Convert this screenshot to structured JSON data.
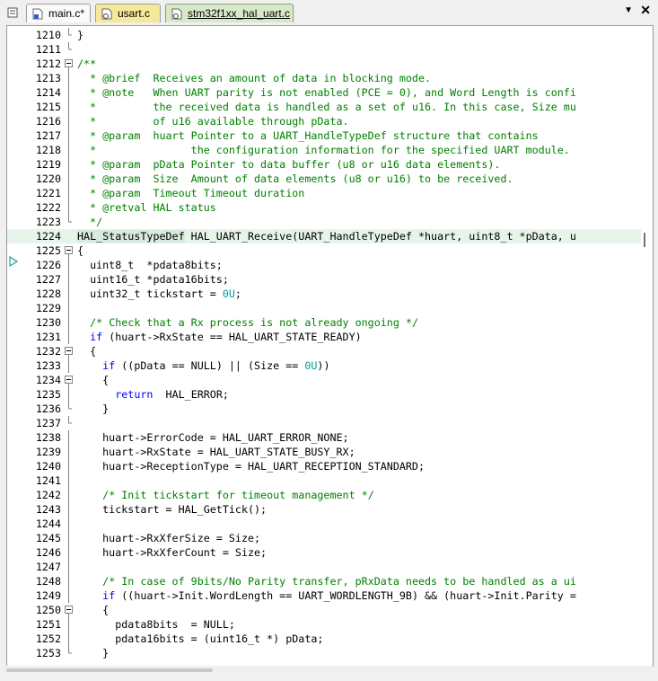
{
  "tabs": [
    {
      "label": "main.c*",
      "active": false
    },
    {
      "label": "usart.c",
      "active": false
    },
    {
      "label": "stm32f1xx_hal_uart.c",
      "active": true
    }
  ],
  "tab_controls": {
    "dropdown_icon": "chevron-down-icon",
    "close_icon": "close-icon"
  },
  "lines": [
    {
      "n": "1210",
      "fold": "end",
      "hl": false,
      "segs": [
        [
          "}",
          "d"
        ]
      ]
    },
    {
      "n": "1211",
      "fold": "end",
      "hl": false,
      "segs": []
    },
    {
      "n": "1212",
      "fold": "open",
      "hl": false,
      "segs": [
        [
          "/**",
          "c"
        ]
      ]
    },
    {
      "n": "1213",
      "fold": "line",
      "hl": false,
      "segs": [
        [
          "  * @brief  Receives an amount of data in blocking mode.",
          "c"
        ]
      ]
    },
    {
      "n": "1214",
      "fold": "line",
      "hl": false,
      "segs": [
        [
          "  * @note   When UART parity is not enabled (PCE = 0), and Word Length is confi",
          "c"
        ]
      ]
    },
    {
      "n": "1215",
      "fold": "line",
      "hl": false,
      "segs": [
        [
          "  *         the received data is handled as a set of u16. In this case, Size mu",
          "c"
        ]
      ]
    },
    {
      "n": "1216",
      "fold": "line",
      "hl": false,
      "segs": [
        [
          "  *         of u16 available through pData.",
          "c"
        ]
      ]
    },
    {
      "n": "1217",
      "fold": "line",
      "hl": false,
      "segs": [
        [
          "  * @param  huart Pointer to a UART_HandleTypeDef structure that contains",
          "c"
        ]
      ]
    },
    {
      "n": "1218",
      "fold": "line",
      "hl": false,
      "segs": [
        [
          "  *               the configuration information for the specified UART module.",
          "c"
        ]
      ]
    },
    {
      "n": "1219",
      "fold": "line",
      "hl": false,
      "segs": [
        [
          "  * @param  pData Pointer to data buffer (u8 or u16 data elements).",
          "c"
        ]
      ]
    },
    {
      "n": "1220",
      "fold": "line",
      "hl": false,
      "segs": [
        [
          "  * @param  Size  Amount of data elements (u8 or u16) to be received.",
          "c"
        ]
      ]
    },
    {
      "n": "1221",
      "fold": "line",
      "hl": false,
      "segs": [
        [
          "  * @param  Timeout Timeout duration",
          "c"
        ]
      ]
    },
    {
      "n": "1222",
      "fold": "line",
      "hl": false,
      "segs": [
        [
          "  * @retval HAL status",
          "c"
        ]
      ]
    },
    {
      "n": "1223",
      "fold": "end",
      "hl": false,
      "segs": [
        [
          "  */",
          "c"
        ]
      ]
    },
    {
      "n": "1224",
      "fold": "none",
      "hl": true,
      "segs": [
        [
          "HAL_StatusTypeDef",
          "w"
        ],
        [
          " HAL_UART_Receive(UART_HandleTypeDef *huart, uint8_t *pData, u",
          "d"
        ]
      ]
    },
    {
      "n": "1225",
      "fold": "open",
      "hl": false,
      "segs": [
        [
          "{",
          "d"
        ]
      ]
    },
    {
      "n": "1226",
      "fold": "line",
      "hl": false,
      "segs": [
        [
          "  uint8_t  *pdata8bits;",
          "d"
        ]
      ]
    },
    {
      "n": "1227",
      "fold": "line",
      "hl": false,
      "segs": [
        [
          "  uint16_t *pdata16bits;",
          "d"
        ]
      ]
    },
    {
      "n": "1228",
      "fold": "line",
      "hl": false,
      "segs": [
        [
          "  uint32_t tickstart = ",
          "d"
        ],
        [
          "0U",
          "n"
        ],
        [
          ";",
          "d"
        ]
      ]
    },
    {
      "n": "1229",
      "fold": "line",
      "hl": false,
      "segs": []
    },
    {
      "n": "1230",
      "fold": "line",
      "hl": false,
      "segs": [
        [
          "  ",
          "d"
        ],
        [
          "/* Check that a Rx process is not already ongoing */",
          "c"
        ]
      ]
    },
    {
      "n": "1231",
      "fold": "line",
      "hl": false,
      "segs": [
        [
          "  ",
          "d"
        ],
        [
          "if",
          "k"
        ],
        [
          " (huart->RxState == HAL_UART_STATE_READY)",
          "d"
        ]
      ]
    },
    {
      "n": "1232",
      "fold": "open",
      "hl": false,
      "segs": [
        [
          "  {",
          "d"
        ]
      ]
    },
    {
      "n": "1233",
      "fold": "line",
      "hl": false,
      "segs": [
        [
          "    ",
          "d"
        ],
        [
          "if",
          "k"
        ],
        [
          " ((pData == NULL) || (Size == ",
          "d"
        ],
        [
          "0U",
          "n"
        ],
        [
          "))",
          "d"
        ]
      ]
    },
    {
      "n": "1234",
      "fold": "open",
      "hl": false,
      "segs": [
        [
          "    {",
          "d"
        ]
      ]
    },
    {
      "n": "1235",
      "fold": "line",
      "hl": false,
      "segs": [
        [
          "      ",
          "d"
        ],
        [
          "return",
          "k"
        ],
        [
          "  HAL_ERROR;",
          "d"
        ]
      ]
    },
    {
      "n": "1236",
      "fold": "end",
      "hl": false,
      "segs": [
        [
          "    }",
          "d"
        ]
      ]
    },
    {
      "n": "1237",
      "fold": "end",
      "hl": false,
      "segs": []
    },
    {
      "n": "1238",
      "fold": "line",
      "hl": false,
      "segs": [
        [
          "    huart->ErrorCode = HAL_UART_ERROR_NONE;",
          "d"
        ]
      ]
    },
    {
      "n": "1239",
      "fold": "line",
      "hl": false,
      "segs": [
        [
          "    huart->RxState = HAL_UART_STATE_BUSY_RX;",
          "d"
        ]
      ]
    },
    {
      "n": "1240",
      "fold": "line",
      "hl": false,
      "segs": [
        [
          "    huart->ReceptionType = HAL_UART_RECEPTION_STANDARD;",
          "d"
        ]
      ]
    },
    {
      "n": "1241",
      "fold": "line",
      "hl": false,
      "segs": []
    },
    {
      "n": "1242",
      "fold": "line",
      "hl": false,
      "segs": [
        [
          "    ",
          "d"
        ],
        [
          "/* Init tickstart for timeout management */",
          "c"
        ]
      ]
    },
    {
      "n": "1243",
      "fold": "line",
      "hl": false,
      "segs": [
        [
          "    tickstart = HAL_GetTick();",
          "d"
        ]
      ]
    },
    {
      "n": "1244",
      "fold": "line",
      "hl": false,
      "segs": []
    },
    {
      "n": "1245",
      "fold": "line",
      "hl": false,
      "segs": [
        [
          "    huart->RxXferSize = Size;",
          "d"
        ]
      ]
    },
    {
      "n": "1246",
      "fold": "line",
      "hl": false,
      "segs": [
        [
          "    huart->RxXferCount = Size;",
          "d"
        ]
      ]
    },
    {
      "n": "1247",
      "fold": "line",
      "hl": false,
      "segs": []
    },
    {
      "n": "1248",
      "fold": "line",
      "hl": false,
      "segs": [
        [
          "    ",
          "d"
        ],
        [
          "/* In case of 9bits/No Parity transfer, pRxData needs to be handled as a ui",
          "c"
        ]
      ]
    },
    {
      "n": "1249",
      "fold": "line",
      "hl": false,
      "segs": [
        [
          "    ",
          "d"
        ],
        [
          "if",
          "k"
        ],
        [
          " ((huart->Init.WordLength == UART_WORDLENGTH_9B) && (huart->Init.Parity =",
          "d"
        ]
      ]
    },
    {
      "n": "1250",
      "fold": "open",
      "hl": false,
      "segs": [
        [
          "    {",
          "d"
        ]
      ]
    },
    {
      "n": "1251",
      "fold": "line",
      "hl": false,
      "segs": [
        [
          "      pdata8bits  = NULL;",
          "d"
        ]
      ]
    },
    {
      "n": "1252",
      "fold": "line",
      "hl": false,
      "segs": [
        [
          "      pdata16bits = (uint16_t *) pData;",
          "d"
        ]
      ]
    },
    {
      "n": "1253",
      "fold": "end",
      "hl": false,
      "segs": [
        [
          "    }",
          "d"
        ]
      ]
    }
  ],
  "colors": {
    "comment": "#008000",
    "keyword": "#0000ff",
    "number": "#00a0a0",
    "highlight": "#e6f4ea"
  }
}
